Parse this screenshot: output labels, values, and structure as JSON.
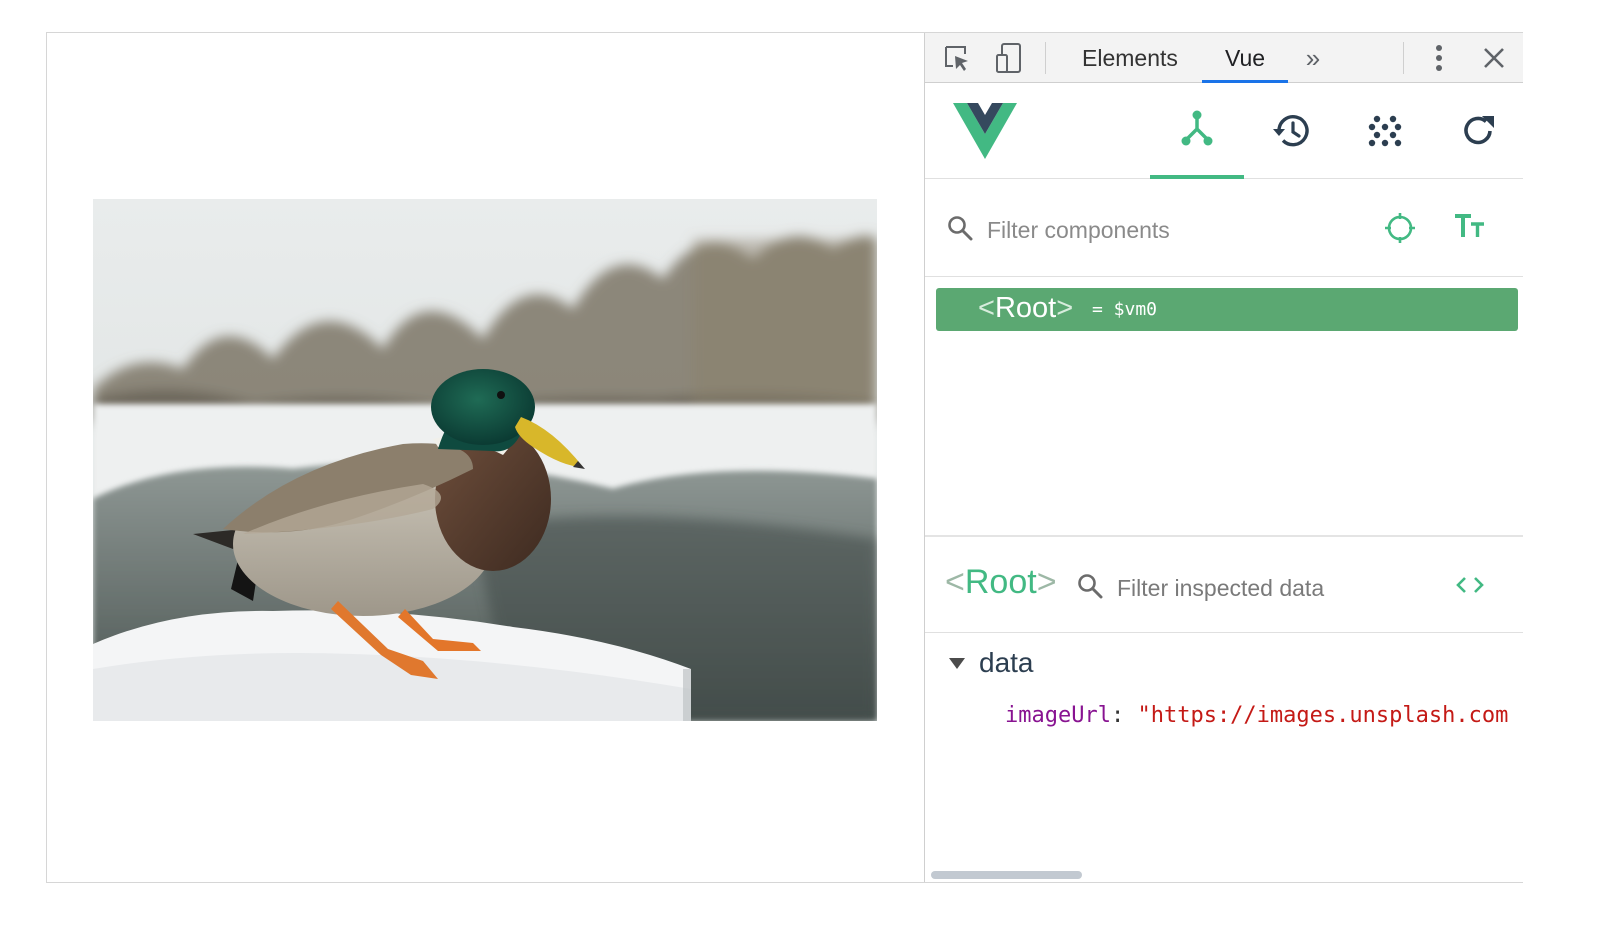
{
  "page": {
    "image": {
      "alt": "mallard-duck-on-snow",
      "colors": {
        "sky": "#e6e9e8",
        "snow": "#f3f4f4",
        "water": "#5b6763",
        "trees": "#6b6150"
      }
    }
  },
  "devtools": {
    "tabs": [
      "Elements",
      "Vue"
    ],
    "active_tab": "Vue",
    "icons": {
      "inspect": "inspect-element-icon",
      "device": "device-toolbar-icon",
      "more_tabs": "chevron-double-right-icon",
      "menu": "more-vertical-icon",
      "close": "close-icon"
    },
    "more_tabs_glyph": "»",
    "close_glyph": "✕",
    "accent": "#1a73e8"
  },
  "vue": {
    "brand_colors": {
      "green": "#42b983",
      "dark": "#35495e"
    },
    "toolbar": [
      {
        "name": "components-icon",
        "active": true
      },
      {
        "name": "history-icon",
        "active": false
      },
      {
        "name": "vuex-dots-icon",
        "active": false
      },
      {
        "name": "refresh-icon",
        "active": false
      }
    ],
    "filter": {
      "placeholder": "Filter components"
    },
    "tree": {
      "open": "<",
      "root": "Root",
      "close": ">",
      "var": "= $vm0",
      "row_color": "#5ba872"
    },
    "inspector": {
      "title_open": "<",
      "title": "Root",
      "title_close": ">",
      "filter_placeholder": "Filter inspected data",
      "section": "data",
      "prop_key": "imageUrl",
      "prop_colon": ": ",
      "prop_value": "\"https://images.unsplash.com"
    }
  }
}
